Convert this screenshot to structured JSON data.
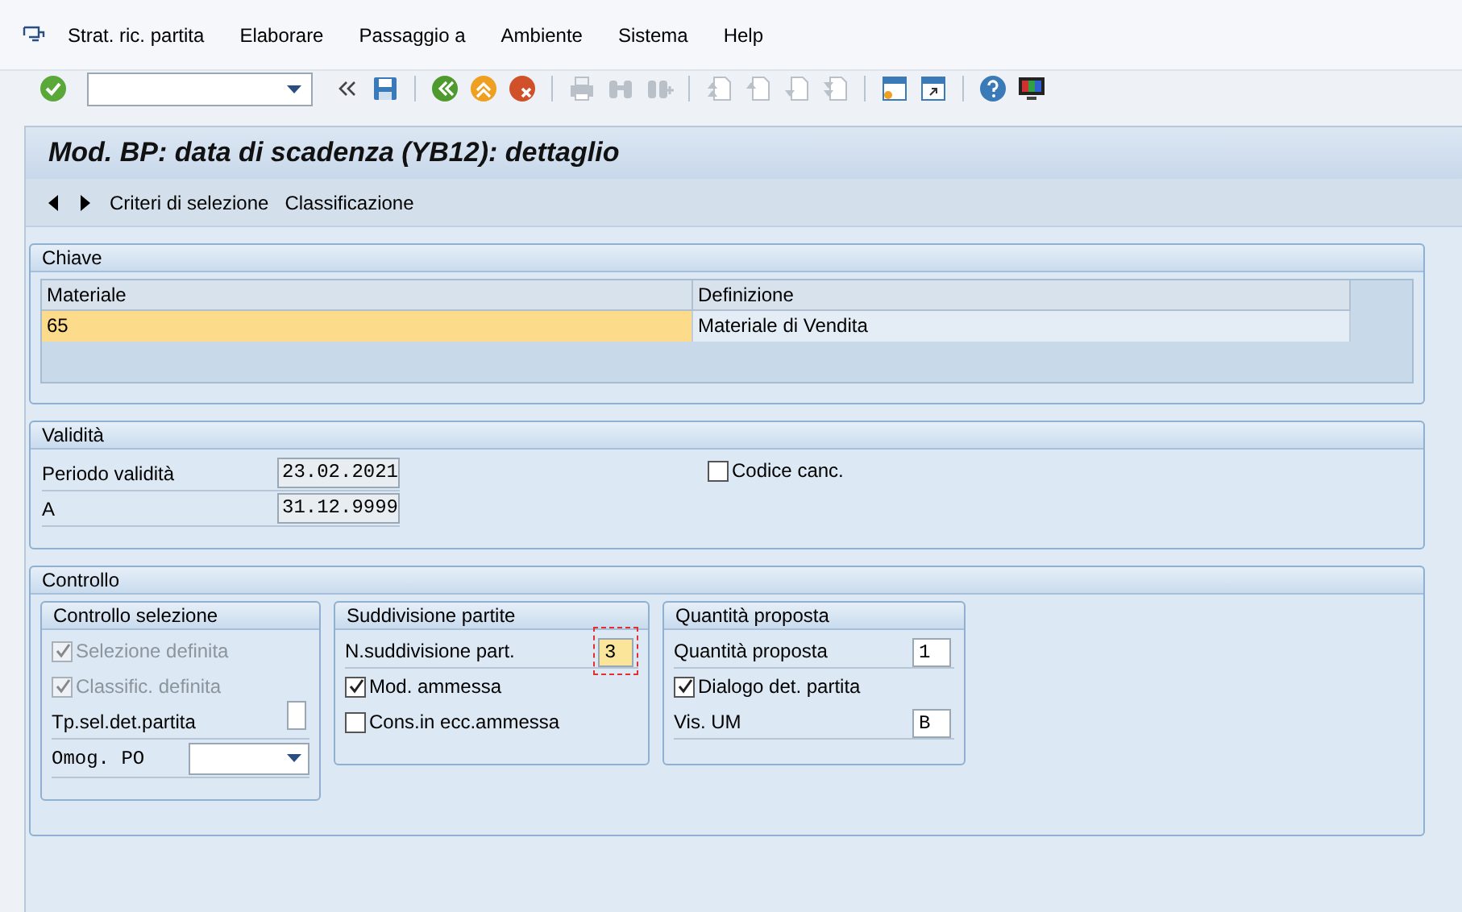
{
  "menu": [
    {
      "label": "Strat. ric. partita"
    },
    {
      "label": "Elaborare"
    },
    {
      "label": "Passaggio a"
    },
    {
      "label": "Ambiente"
    },
    {
      "label": "Sistema"
    },
    {
      "label": "Help"
    }
  ],
  "toolbar": [
    {
      "kind": "enter",
      "disabled": false
    },
    {
      "kind": "command"
    },
    {
      "kind": "collapse",
      "disabled": false
    },
    {
      "kind": "save",
      "disabled": false
    },
    {
      "kind": "sep"
    },
    {
      "kind": "back",
      "disabled": false
    },
    {
      "kind": "exit",
      "disabled": false
    },
    {
      "kind": "cancel",
      "disabled": false
    },
    {
      "kind": "sep"
    },
    {
      "kind": "print",
      "disabled": true
    },
    {
      "kind": "find",
      "disabled": true
    },
    {
      "kind": "find_next",
      "disabled": true
    },
    {
      "kind": "sep"
    },
    {
      "kind": "first",
      "disabled": true
    },
    {
      "kind": "prev",
      "disabled": true
    },
    {
      "kind": "next",
      "disabled": true
    },
    {
      "kind": "last",
      "disabled": true
    },
    {
      "kind": "sep"
    },
    {
      "kind": "new_session",
      "disabled": false
    },
    {
      "kind": "shortcut",
      "disabled": false
    },
    {
      "kind": "sep"
    },
    {
      "kind": "help",
      "disabled": false
    },
    {
      "kind": "layout",
      "disabled": false
    }
  ],
  "title": "Mod. BP: data di scadenza (YB12): dettaglio",
  "app_toolbar": [
    {
      "kind": "prev_arrow"
    },
    {
      "kind": "next_arrow"
    },
    {
      "kind": "text",
      "label": "Criteri di selezione"
    },
    {
      "kind": "text",
      "label": "Classificazione"
    }
  ],
  "chiave": {
    "title": "Chiave",
    "columns": [
      "Materiale",
      "Definizione"
    ],
    "rows": [
      {
        "cells": [
          "65",
          "Materiale di Vendita"
        ],
        "selected": true
      }
    ]
  },
  "validita": {
    "title": "Validità",
    "fields": [
      {
        "label": "Periodo validità",
        "value": "23.02.2021"
      },
      {
        "label": "A",
        "value": "31.12.9999"
      }
    ],
    "checkbox": {
      "label": "Codice canc.",
      "checked": false
    }
  },
  "controllo": {
    "title": "Controllo",
    "groups": [
      {
        "title": "Controllo selezione",
        "items": [
          {
            "kind": "checkbox",
            "label": "Selezione definita",
            "checked": true,
            "disabled": true
          },
          {
            "kind": "checkbox",
            "label": "Classific. definita",
            "checked": true,
            "disabled": true
          },
          {
            "kind": "field",
            "label": "Tp.sel.det.partita"
          },
          {
            "kind": "dropdown",
            "label": "Omog. PO"
          }
        ]
      },
      {
        "title": "Suddivisione partite",
        "items": [
          {
            "kind": "field",
            "label": "N.suddivisione part.",
            "value": "3",
            "focused": true
          },
          {
            "kind": "checkbox",
            "label": "Mod. ammessa",
            "checked": true,
            "disabled": false
          },
          {
            "kind": "checkbox",
            "label": "Cons.in ecc.ammessa",
            "checked": false,
            "disabled": false
          }
        ]
      },
      {
        "title": "Quantità proposta",
        "items": [
          {
            "kind": "field",
            "label": "Quantità proposta",
            "value": "1",
            "focused": false
          },
          {
            "kind": "checkbox",
            "label": "Dialogo det. partita",
            "checked": true,
            "disabled": false
          },
          {
            "kind": "field",
            "label": "Vis. UM",
            "value": "B",
            "focused": false
          }
        ]
      }
    ]
  }
}
